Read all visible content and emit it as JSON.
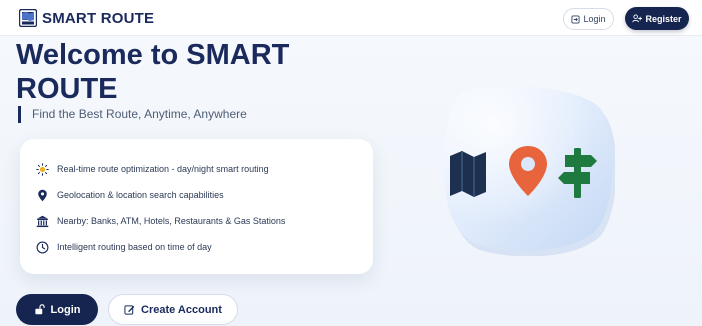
{
  "header": {
    "brand_name": "SMART ROUTE",
    "brand_logo_icon": "map-logo-icon",
    "login_label": "Login",
    "register_label": "Register"
  },
  "hero": {
    "title": "Welcome to SMART ROUTE",
    "tagline": "Find the Best Route, Anytime, Anywhere"
  },
  "features": [
    {
      "icon": "sun-icon",
      "label": "Real-time route optimization - day/night smart routing"
    },
    {
      "icon": "location-pin-icon",
      "label": "Geolocation & location search capabilities"
    },
    {
      "icon": "bank-icon",
      "label": "Nearby: Banks, ATM, Hotels, Restaurants & Gas Stations"
    },
    {
      "icon": "clock-icon",
      "label": "Intelligent routing based on time of day"
    }
  ],
  "actions": {
    "login_label": "Login",
    "create_account_label": "Create Account"
  },
  "illustration": {
    "icons": [
      "map-icon",
      "location-pin-icon",
      "signpost-icon"
    ]
  },
  "colors": {
    "brand_navy": "#16254f",
    "pin_orange": "#e8643c",
    "signpost_green": "#1f7a3f",
    "map_navy": "#1e3050",
    "tile_blue": "#dbe8fb"
  }
}
